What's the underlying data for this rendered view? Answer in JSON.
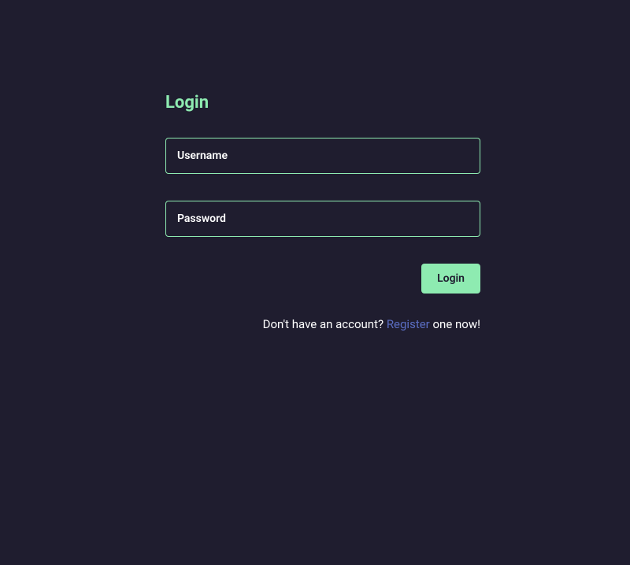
{
  "login": {
    "title": "Login",
    "username_placeholder": "Username",
    "password_placeholder": "Password",
    "button_label": "Login",
    "register_prefix": "Don't have an account? ",
    "register_link": "Register",
    "register_suffix": " one now!"
  }
}
